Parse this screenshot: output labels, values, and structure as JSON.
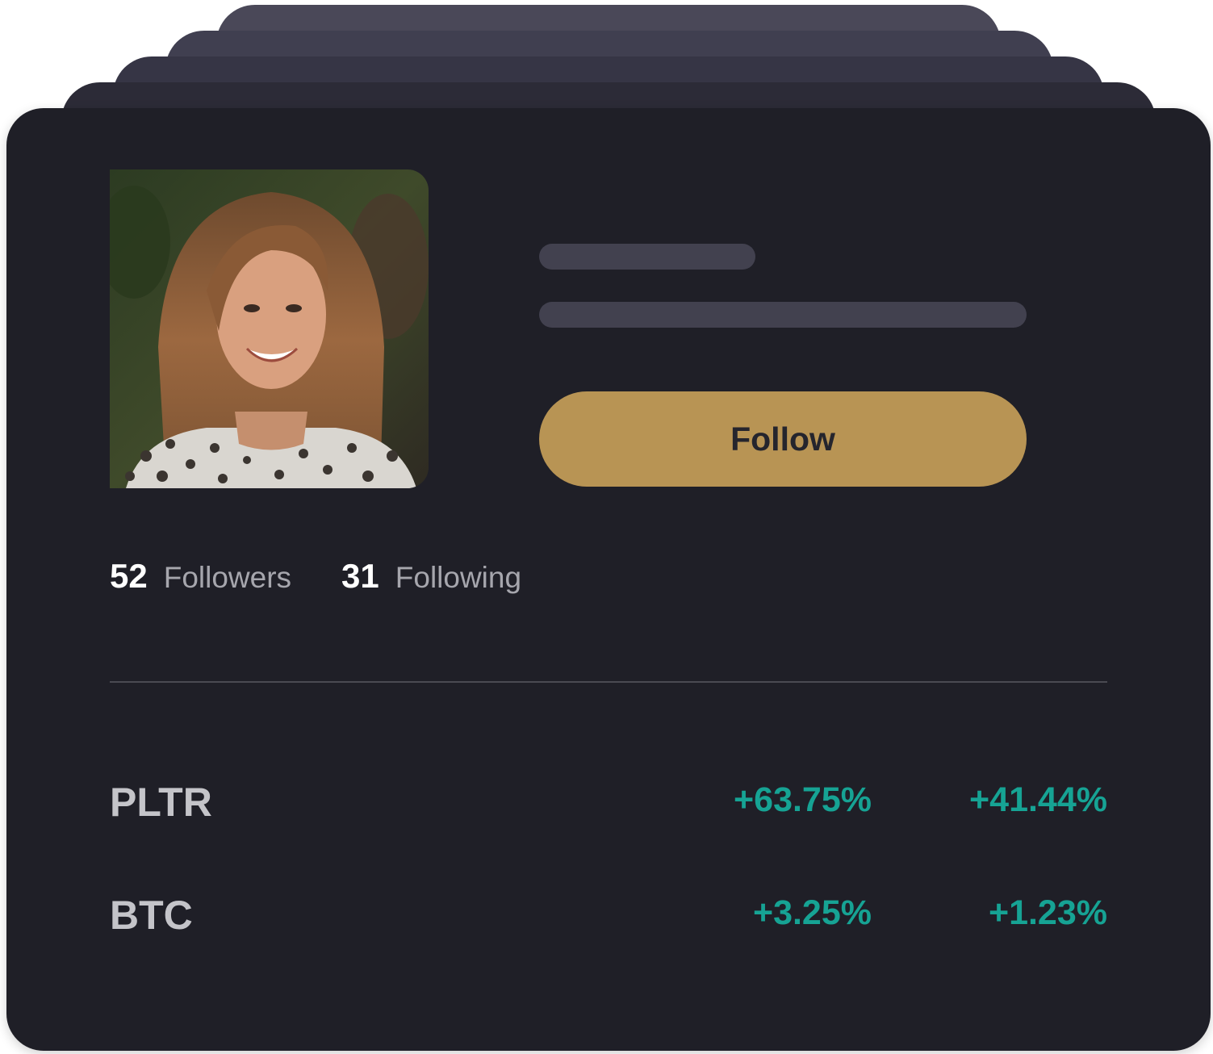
{
  "profile": {
    "follow_label": "Follow",
    "followers_count": "52",
    "followers_label": "Followers",
    "following_count": "31",
    "following_label": "Following"
  },
  "holdings": [
    {
      "ticker": "PLTR",
      "change_1": "+63.75%",
      "change_2": "+41.44%"
    },
    {
      "ticker": "BTC",
      "change_1": "+3.25%",
      "change_2": "+1.23%"
    }
  ],
  "colors": {
    "card_background": "#1f1f27",
    "follow_button": "#b89454",
    "positive_change": "#16a394",
    "skeleton": "#42414f"
  },
  "icons": {
    "avatar": "profile-photo"
  }
}
